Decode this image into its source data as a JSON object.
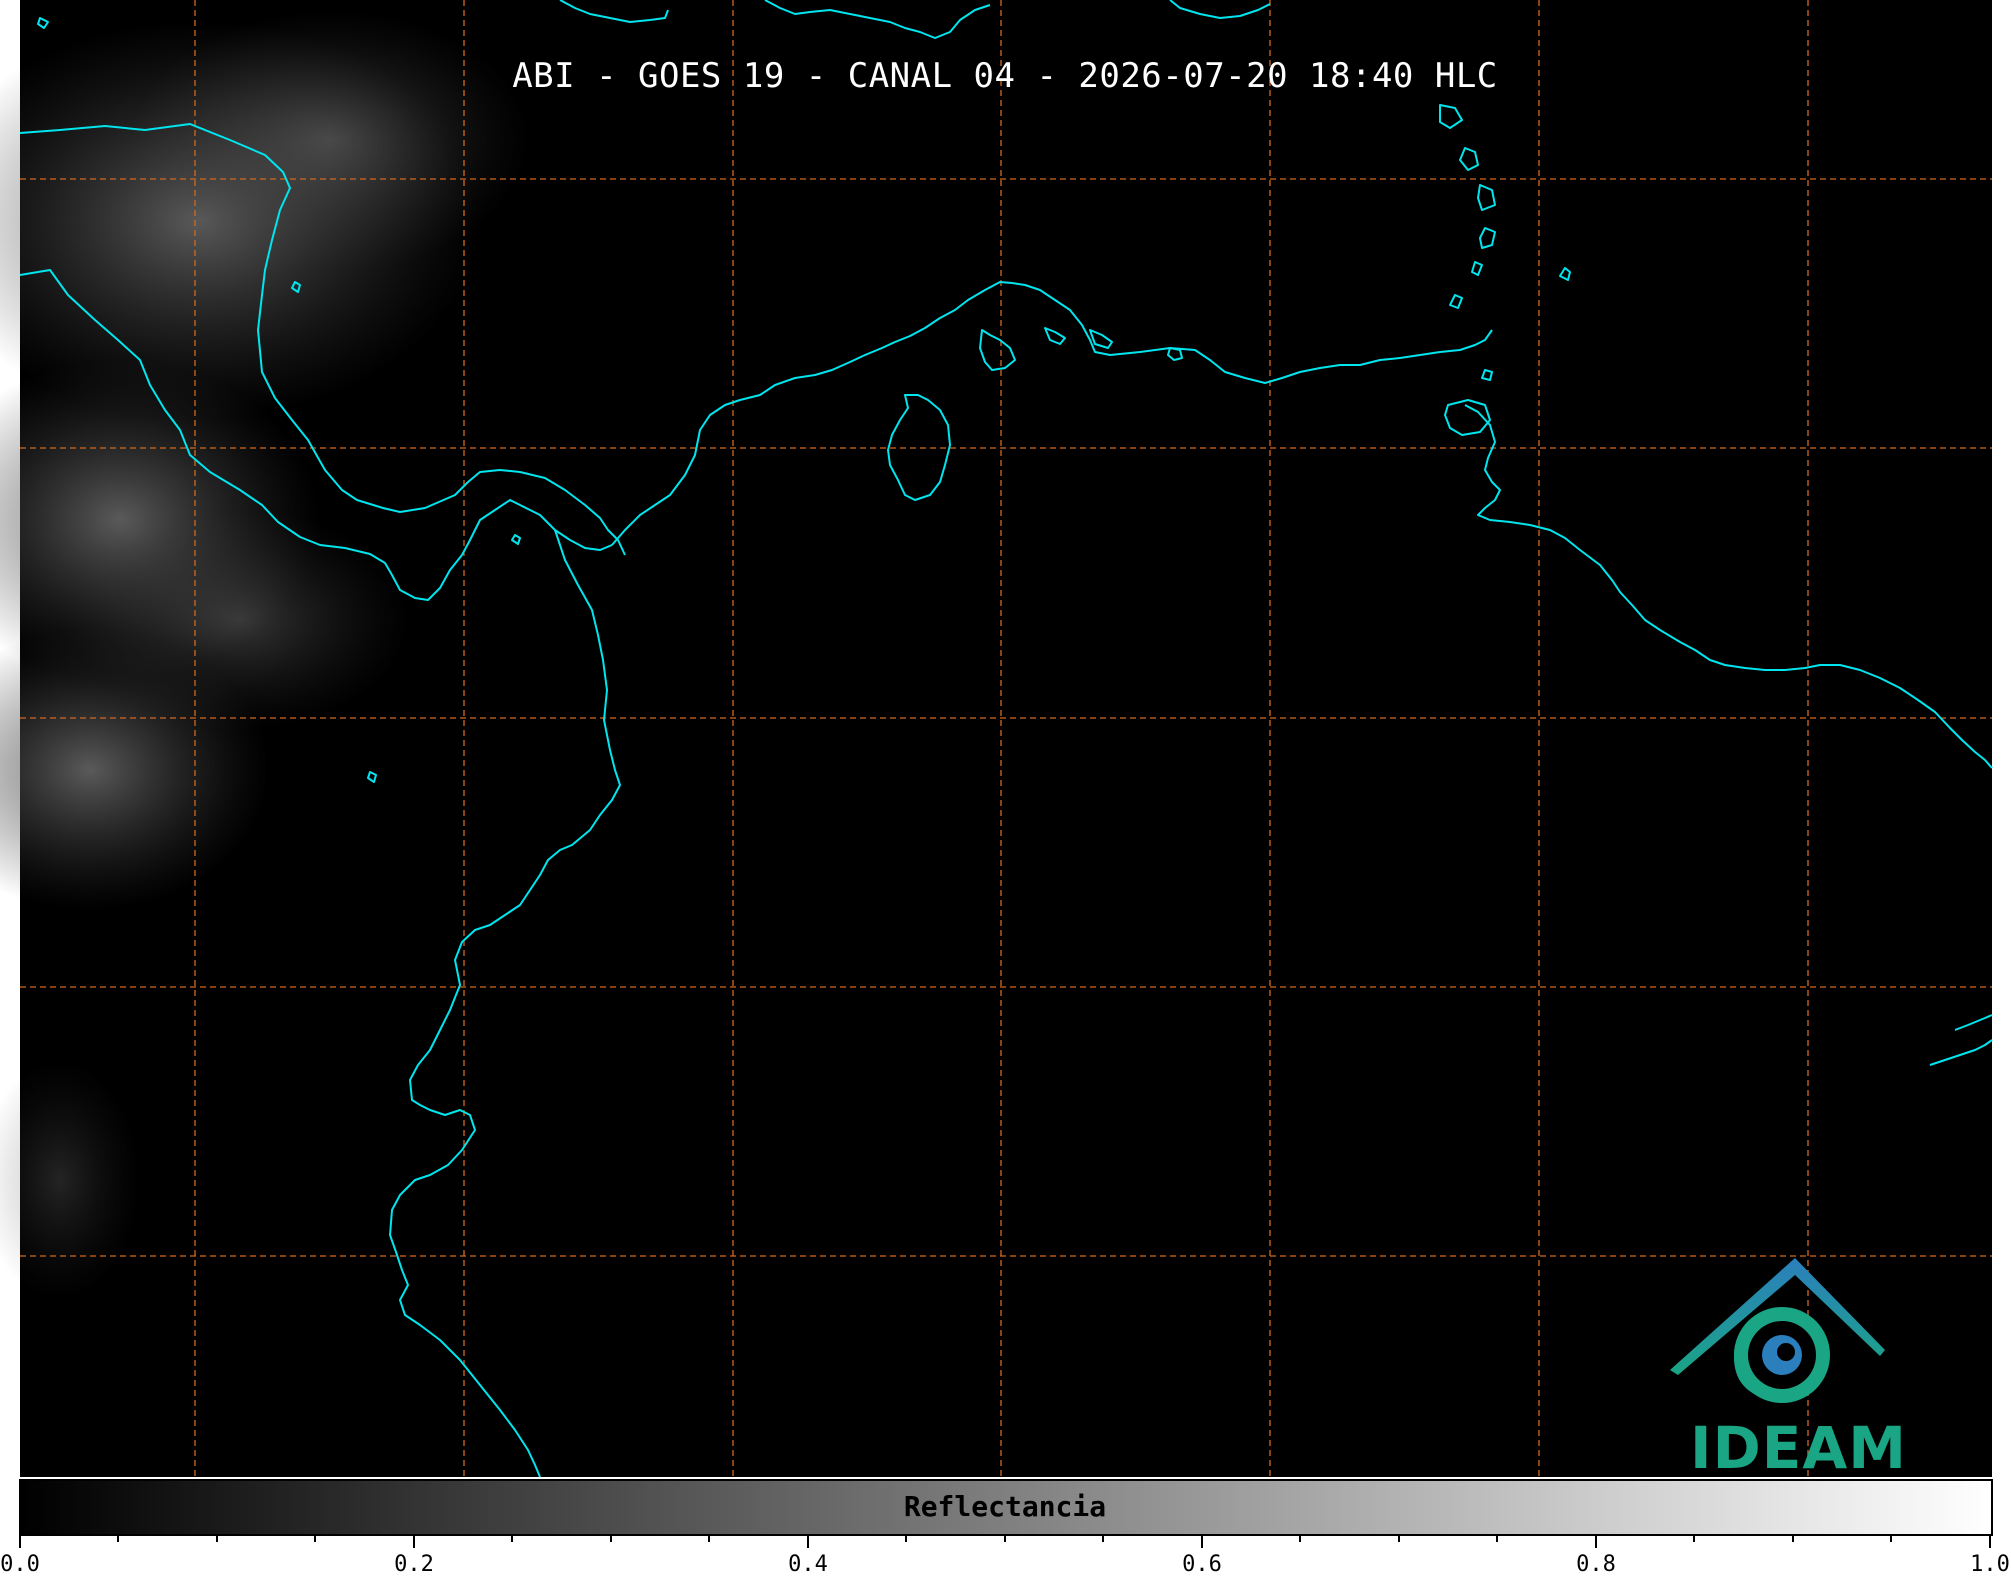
{
  "title": "ABI - GOES 19 - CANAL 04 - 2026-07-20 18:40 HLC",
  "colorbar": {
    "label": "Reflectancia",
    "ticks": [
      "0.0",
      "0.2",
      "0.4",
      "0.6",
      "0.8",
      "1.0"
    ],
    "range": [
      0.0,
      1.0
    ],
    "colormap": "greys"
  },
  "logo": {
    "text": "IDEAM",
    "color": "#1aa585"
  },
  "colors": {
    "background": "#000000",
    "coastline": "#00e5ee",
    "gridline": "#d2691e",
    "logo_teal": "#1aa585",
    "logo_blue": "#2b7fbd"
  },
  "gridlines": {
    "style": "dashed",
    "visible": true
  }
}
